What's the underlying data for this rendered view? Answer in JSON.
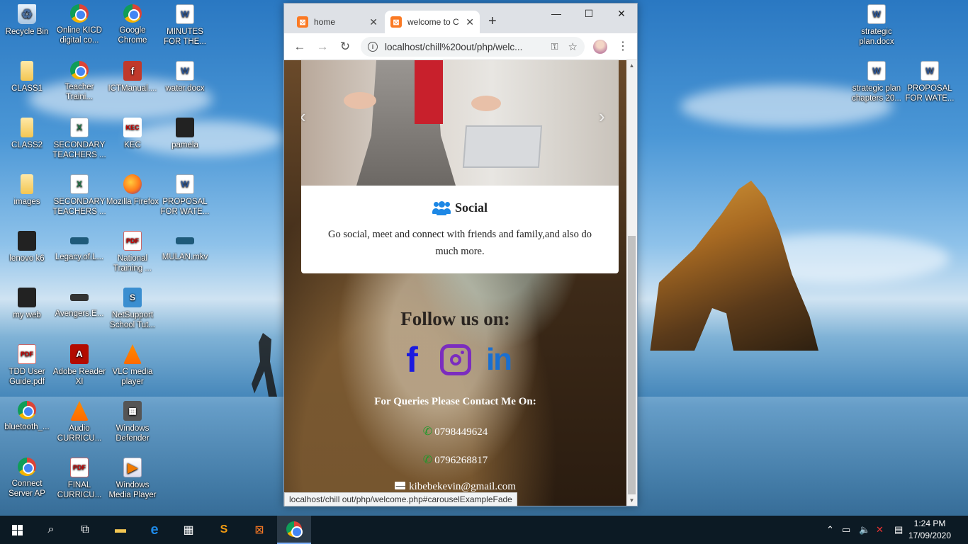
{
  "desktop": {
    "icons": [
      {
        "label": "Recycle Bin",
        "icon": "recycle-bin-icon"
      },
      {
        "label": "Online KICD digital co...",
        "icon": "chrome-icon"
      },
      {
        "label": "Google Chrome",
        "icon": "chrome-icon"
      },
      {
        "label": "MINUTES FOR THE...",
        "icon": "word-document-icon"
      },
      {
        "label": "CLASS1",
        "icon": "folder-icon"
      },
      {
        "label": "Teacher Traini...",
        "icon": "chrome-icon"
      },
      {
        "label": "ICTManual....",
        "icon": "flash-file-icon"
      },
      {
        "label": "water.docx",
        "icon": "word-document-icon"
      },
      {
        "label": "CLASS2",
        "icon": "folder-icon"
      },
      {
        "label": "SECONDARY TEACHERS ...",
        "icon": "excel-file-icon"
      },
      {
        "label": "KEC",
        "icon": "kec-shortcut-icon"
      },
      {
        "label": "pamela",
        "icon": "folder-icon"
      },
      {
        "label": "images",
        "icon": "folder-icon"
      },
      {
        "label": "SECONDARY TEACHERS ...",
        "icon": "excel-file-icon"
      },
      {
        "label": "Mozilla Firefox",
        "icon": "firefox-icon"
      },
      {
        "label": "PROPOSAL FOR WATE...",
        "icon": "word-document-icon"
      },
      {
        "label": "lenovo k6",
        "icon": "folder-icon"
      },
      {
        "label": "Legacy.of.L...",
        "icon": "video-file-icon"
      },
      {
        "label": "National Training ...",
        "icon": "pdf-file-icon"
      },
      {
        "label": "MULAN.mkv",
        "icon": "video-file-icon"
      },
      {
        "label": "my web",
        "icon": "folder-icon"
      },
      {
        "label": "Avengers.E...",
        "icon": "video-file-icon"
      },
      {
        "label": "NetSupport School Tut...",
        "icon": "netsupport-icon"
      },
      {
        "label": "TDD User Guide.pdf",
        "icon": "pdf-file-icon"
      },
      {
        "label": "Adobe Reader XI",
        "icon": "adobe-reader-icon"
      },
      {
        "label": "VLC media player",
        "icon": "vlc-icon"
      },
      {
        "label": "bluetooth_...",
        "icon": "chrome-icon"
      },
      {
        "label": "Audio CURRICU...",
        "icon": "vlc-icon"
      },
      {
        "label": "Windows Defender",
        "icon": "windows-defender-icon"
      },
      {
        "label": "Connect Server AP",
        "icon": "chrome-icon"
      },
      {
        "label": "FINAL CURRICU...",
        "icon": "pdf-file-icon"
      },
      {
        "label": "Windows Media Player",
        "icon": "windows-media-player-icon"
      },
      {
        "label": "strategic plan.docx",
        "icon": "word-document-icon"
      },
      {
        "label": "strategic plan chapters 20...",
        "icon": "word-document-icon"
      },
      {
        "label": "PROPOSAL FOR WATE...",
        "icon": "word-document-icon"
      }
    ]
  },
  "browser": {
    "tabs": [
      {
        "title": "home",
        "active": false
      },
      {
        "title": "welcome to C",
        "active": true
      }
    ],
    "url": "localhost/chill%20out/php/welc...",
    "status_url": "localhost/chill out/php/welcome.php#carouselExampleFade"
  },
  "page": {
    "card_title": "Social",
    "card_text": "Go social, meet and connect with friends and family,and also do much more.",
    "follow_title": "Follow us on:",
    "contact_title": "For Queries Please Contact Me On:",
    "phone1": "0798449624",
    "phone2": "0796268817",
    "email": "kibebekevin@gmail.com"
  },
  "taskbar": {
    "time": "1:24 PM",
    "date": "17/09/2020"
  },
  "colors": {
    "facebook": "#1a1ae0",
    "instagram": "#7b2cbf",
    "linkedin": "#1a6fd0",
    "users_icon": "#1e88e5",
    "phone_icon": "#1d9a2a"
  }
}
